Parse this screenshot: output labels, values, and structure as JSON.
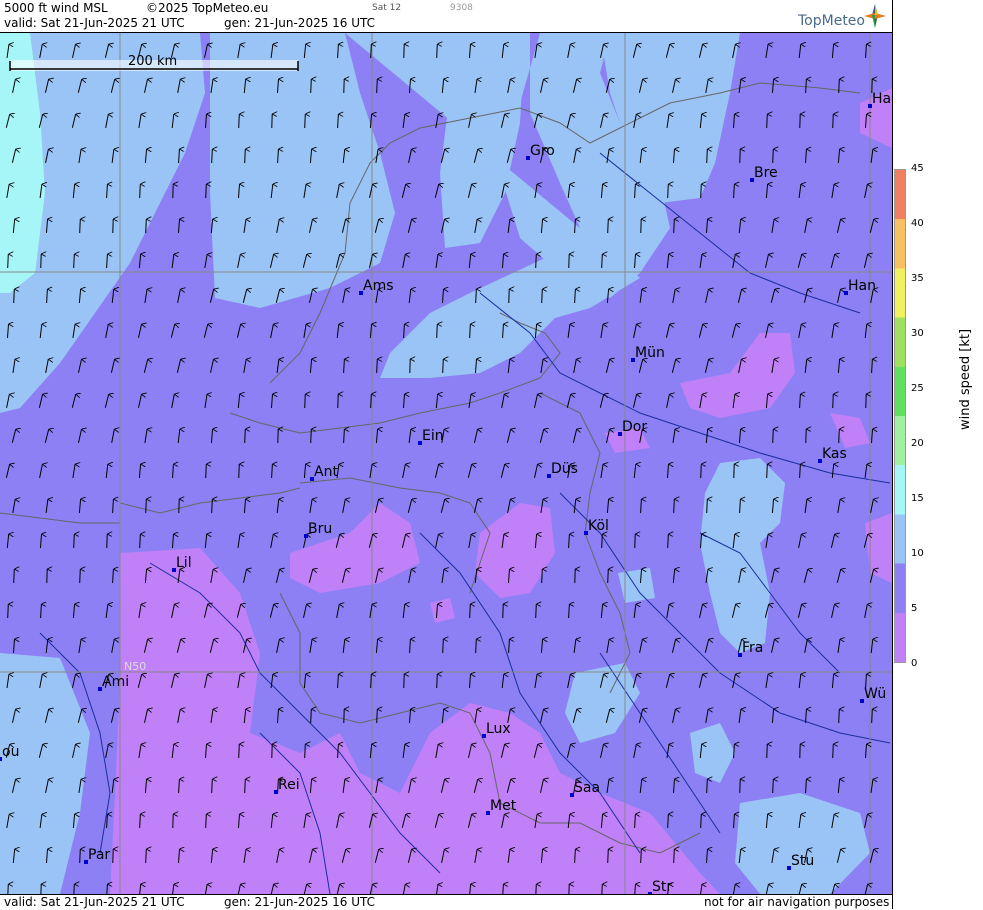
{
  "header": {
    "product": "5000 ft wind MSL",
    "copyright": "©2025 TopMeteo.eu",
    "valid": "valid:  Sat  21-Jun-2025  21 UTC",
    "gen": "gen: 21-Jun-2025 16 UTC",
    "day_code": "Sat 12",
    "code": "9308",
    "logo": "TopMeteo"
  },
  "footer": {
    "valid": "valid:  Sat  21-Jun-2025  21 UTC",
    "gen": "gen: 21-Jun-2025 16 UTC",
    "disclaimer": "not for air navigation purposes"
  },
  "map": {
    "scale_label": "200 km",
    "lat_label": "N50",
    "cities": [
      {
        "label": "Gro"
      },
      {
        "label": "Bre"
      },
      {
        "label": "Ha"
      },
      {
        "label": "Ams"
      },
      {
        "label": "Han"
      },
      {
        "label": "Mün"
      },
      {
        "label": "Dor"
      },
      {
        "label": "Ein"
      },
      {
        "label": "Kas"
      },
      {
        "label": "Düs"
      },
      {
        "label": "Ant"
      },
      {
        "label": "Köl"
      },
      {
        "label": "Bru"
      },
      {
        "label": "Lil"
      },
      {
        "label": "Fra"
      },
      {
        "label": "Ami"
      },
      {
        "label": "Wü"
      },
      {
        "label": "Lux"
      },
      {
        "label": "ou"
      },
      {
        "label": "Rei"
      },
      {
        "label": "Saa"
      },
      {
        "label": "Met"
      },
      {
        "label": "Par"
      },
      {
        "label": "Stu"
      },
      {
        "label": "Str"
      }
    ],
    "colors": {
      "speed_0_5": "#c080f8",
      "speed_5_10": "#8c80f4",
      "speed_10_15": "#9ac4f6",
      "speed_15_20": "#a6f6f8",
      "border": "#666666",
      "river": "#1a2ea0",
      "grid": "#888888",
      "city": "#0000cc"
    }
  },
  "colorbar": {
    "title": "wind speed [kt]",
    "ticks": [
      "45",
      "40",
      "35",
      "30",
      "25",
      "20",
      "15",
      "10",
      "5",
      "0"
    ],
    "bands": [
      "#c080f8",
      "#8c80f4",
      "#9ac4f6",
      "#a6f6f8",
      "#a0f0a0",
      "#60e060",
      "#a0e060",
      "#f0f060",
      "#f8c060",
      "#f08060"
    ]
  }
}
